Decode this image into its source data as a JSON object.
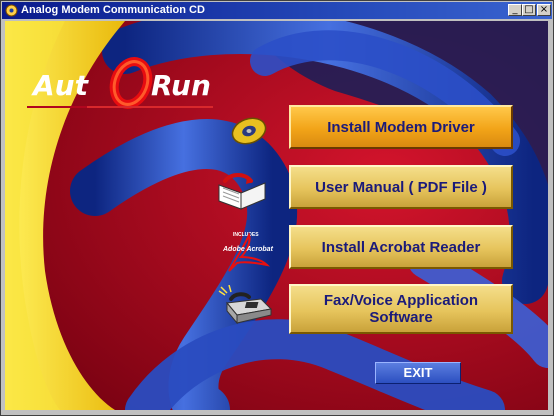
{
  "window": {
    "title": "Analog Modem Communication CD",
    "controls": {
      "minimize": "_",
      "maximize": "□",
      "close": "×"
    }
  },
  "logo": {
    "part1": "Aut",
    "part2": "Run"
  },
  "menu": [
    {
      "label": "Install Modem Driver",
      "icon": "cd-disc-icon",
      "active": true
    },
    {
      "label": "User Manual ( PDF File )",
      "icon": "open-book-icon",
      "active": false
    },
    {
      "label": "Install Acrobat Reader",
      "icon": "adobe-acrobat-icon",
      "active": false
    },
    {
      "label_line1": "Fax/Voice Application",
      "label_line2": "Software",
      "icon": "fax-machine-icon",
      "active": false
    }
  ],
  "exit_label": "EXIT",
  "colors": {
    "background_red": "#b0061e",
    "swoosh_yellow": "#f3d21a",
    "tube_blue": "#2848b0",
    "button_gold": "#e6c45c",
    "button_text": "#1b1b7a"
  }
}
